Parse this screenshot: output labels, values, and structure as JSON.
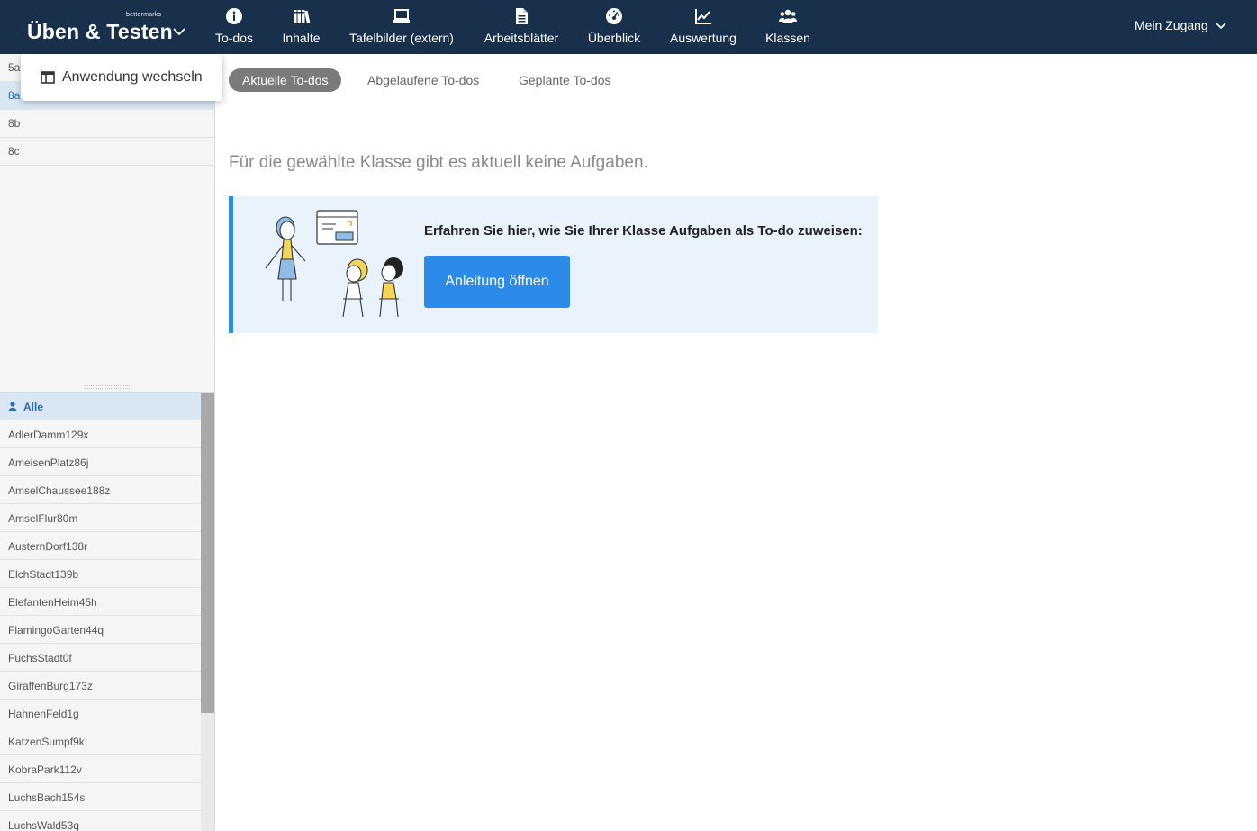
{
  "brand": {
    "small": "bettermarks",
    "title": "Üben & Testen"
  },
  "nav": [
    {
      "label": "To-dos",
      "icon": "info-icon"
    },
    {
      "label": "Inhalte",
      "icon": "books-icon"
    },
    {
      "label": "Tafelbilder (extern)",
      "icon": "laptop-icon"
    },
    {
      "label": "Arbeitsblätter",
      "icon": "document-icon"
    },
    {
      "label": "Überblick",
      "icon": "dashboard-icon"
    },
    {
      "label": "Auswertung",
      "icon": "chart-icon"
    },
    {
      "label": "Klassen",
      "icon": "users-icon"
    }
  ],
  "account": {
    "label": "Mein Zugang"
  },
  "popup": {
    "label": "Anwendung wechseln",
    "icon": "switch-app-icon"
  },
  "classes": [
    "5a",
    "8a",
    "8b",
    "8c"
  ],
  "active_class": "8a",
  "students": {
    "all_label": "Alle",
    "items": [
      "AdlerDamm129x",
      "AmeisenPlatz86j",
      "AmselChaussee188z",
      "AmselFlur80m",
      "AusternDorf138r",
      "ElchStadt139b",
      "ElefantenHeim45h",
      "FlamingoGarten44q",
      "FuchsStadt0f",
      "GiraffenBurg173z",
      "HahnenFeld1g",
      "KatzenSumpf9k",
      "KobraPark112v",
      "LuchsBach154s",
      "LuchsWald53q"
    ]
  },
  "tabs": [
    "Aktuelle To-dos",
    "Abgelaufene To-dos",
    "Geplante To-dos"
  ],
  "active_tab": "Aktuelle To-dos",
  "main": {
    "empty_message": "Für die gewählte Klasse gibt es aktuell keine Aufgaben.",
    "info_text": "Erfahren Sie hier, wie Sie Ihrer Klasse Aufgaben als To-do zuweisen:",
    "info_button": "Anleitung öffnen"
  },
  "colors": {
    "topbar": "#19304d",
    "accent": "#2c8ae8",
    "info_bg": "#eaf2fb",
    "active_row": "#d9e6f3"
  }
}
